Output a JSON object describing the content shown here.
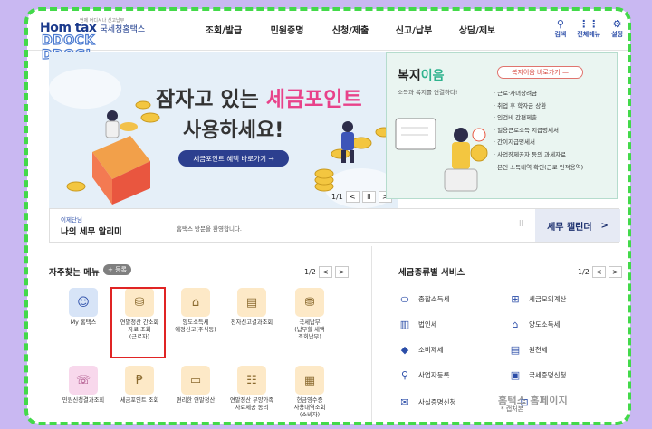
{
  "header": {
    "logo_main": "Hom  tax",
    "logo_sub": "국세청홈택스",
    "logo_tag": "언제 어디서나 신고납부",
    "overlay_text_1": "DDOCK",
    "overlay_text_2": "DDOGI",
    "nav": [
      "조회/발급",
      "민원증명",
      "신청/제출",
      "신고/납부",
      "상담/제보"
    ],
    "util": [
      {
        "icon": "search-icon",
        "glyph": "⚲",
        "label": "검색"
      },
      {
        "icon": "grid-menu-icon",
        "glyph": "⋮⋮",
        "label": "전체메뉴"
      },
      {
        "icon": "gear-icon",
        "glyph": "⚙",
        "label": "설정"
      }
    ]
  },
  "banner_left": {
    "title_prefix": "잠자고 있는 ",
    "title_accent": "세금포인트",
    "title_line2": "사용하세요!",
    "button_label": "세금포인트 혜택 바로가기  →",
    "pager_text": "1/1",
    "prev": "<",
    "pause": "ll",
    "next": ">"
  },
  "banner_right": {
    "title_prefix": "복지",
    "title_accent": "이음",
    "subtitle": "소득과 복지를 연결하다!",
    "button_label": "복지이음 바로가기  —",
    "items": [
      "근로·자녀장려금",
      "취업 후 학자금 상환",
      "인건비 간편제출",
      "일용근로소득 지급명세서",
      "간이지급명세서",
      "사업장제공자 등의 과세자료",
      "본인 소득내역 확인(근로·인적용역)"
    ]
  },
  "notice": {
    "tag": "이제단님",
    "title": "나의 세무 알리미",
    "text": "홈택스 방문을 환영합니다.",
    "pause": "ll",
    "calendar_label": "세무 캘린더",
    "calendar_arrow": ">"
  },
  "freq_menu": {
    "title": "자주찾는 메뉴",
    "add_label": "+ 등록",
    "pager_text": "1/2",
    "prev": "<",
    "next": ">",
    "items": [
      {
        "label": "My 홈택스",
        "icon": "person-icon",
        "glyph": "☺",
        "style": "blue"
      },
      {
        "label": "연말정산 간소화\n자료 조회\n(근로자)",
        "icon": "piggy-bank-icon",
        "glyph": "⛁",
        "style": "yellow"
      },
      {
        "label": "양도소득세\n예정신고(주식등)",
        "icon": "house-coin-icon",
        "glyph": "⌂",
        "style": "yellow"
      },
      {
        "label": "전자신고결과조회",
        "icon": "document-w-icon",
        "glyph": "▤",
        "style": "yellow"
      },
      {
        "label": "국세납부\n(납부할 세액\n조회납부)",
        "icon": "coin-stack-icon",
        "glyph": "⛃",
        "style": "yellow"
      },
      {
        "label": "민원신청결과조회",
        "icon": "headset-icon",
        "glyph": "☏",
        "style": "pink"
      },
      {
        "label": "세금포인트 조회",
        "icon": "point-card-icon",
        "glyph": "₱",
        "style": "yellow"
      },
      {
        "label": "편리한 연말정산",
        "icon": "laptop-coin-icon",
        "glyph": "▭",
        "style": "yellow"
      },
      {
        "label": "연말정산 부양가족\n자료제공 동의",
        "icon": "family-doc-icon",
        "glyph": "☷",
        "style": "yellow"
      },
      {
        "label": "현금영수증\n사용내역조회\n(소비자)",
        "icon": "receipt-icon",
        "glyph": "▦",
        "style": "yellow"
      }
    ]
  },
  "tax_services": {
    "title": "세금종류별 서비스",
    "pager_text": "1/2",
    "prev": "<",
    "next": ">",
    "items": [
      {
        "label": "종합소득세",
        "icon": "coin-hand-icon",
        "glyph": "⛀"
      },
      {
        "label": "세금모의계산",
        "icon": "calculator-icon",
        "glyph": "⊞"
      },
      {
        "label": "법인세",
        "icon": "building-icon",
        "glyph": "▥"
      },
      {
        "label": "양도소득세",
        "icon": "house-icon",
        "glyph": "⌂"
      },
      {
        "label": "소비제세",
        "icon": "diamond-icon",
        "glyph": "◆"
      },
      {
        "label": "원천세",
        "icon": "document-icon",
        "glyph": "▤"
      },
      {
        "label": "사업자등록",
        "icon": "user-search-icon",
        "glyph": "⚲"
      },
      {
        "label": "국세증명신청",
        "icon": "certificate-icon",
        "glyph": "▣"
      },
      {
        "label": "사실증명신청",
        "icon": "doc-check-icon",
        "glyph": "✉"
      },
      {
        "label": "",
        "icon": "bookmark-icon",
        "glyph": "⊡"
      }
    ],
    "watermark": "홈택스 홈페이지",
    "watermark_note": "* 캡처본"
  },
  "colors": {
    "accent_pink": "#e8428a",
    "navy": "#2c3f8f",
    "green_border": "#43d94a",
    "teal": "#2fb38e"
  }
}
